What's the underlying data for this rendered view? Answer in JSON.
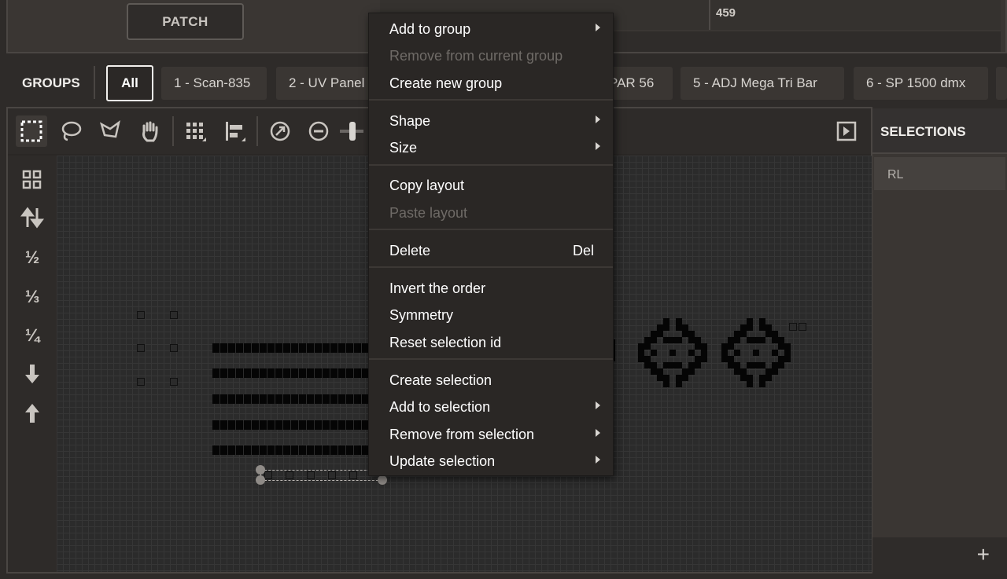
{
  "top": {
    "patch_label": "PATCH",
    "field_value": "459"
  },
  "groups": {
    "title": "GROUPS",
    "tabs": [
      {
        "label": "All",
        "active": true
      },
      {
        "label": "1 - Scan-835"
      },
      {
        "label": "2 - UV Panel"
      },
      {
        "label": "PAR 56"
      },
      {
        "label": "5 - ADJ Mega Tri Bar"
      },
      {
        "label": "6 - SP 1500 dmx"
      }
    ]
  },
  "toolbar": {
    "tools": [
      "select-rect-icon",
      "lasso-icon",
      "polygon-lasso-icon",
      "hand-icon",
      "grid-icon",
      "align-icon",
      "zoom-fit-icon",
      "zoom-out-icon",
      "zoom-slider-icon"
    ],
    "panel_toggle": "panel-toggle-icon"
  },
  "side_tools": {
    "items": [
      "grid-4-icon",
      "swap-vertical-icon",
      "½",
      "⅓",
      "¼",
      "arrow-down-icon",
      "arrow-up-icon"
    ]
  },
  "selections": {
    "title": "SELECTIONS",
    "items": [
      "RL"
    ],
    "add_label": "+"
  },
  "context_menu": {
    "items": [
      {
        "label": "Add to group",
        "submenu": true
      },
      {
        "label": "Remove from current group",
        "disabled": true
      },
      {
        "label": "Create new group"
      },
      {
        "label": "Shape",
        "submenu": true
      },
      {
        "label": "Size",
        "submenu": true
      },
      {
        "label": "Copy layout"
      },
      {
        "label": "Paste layout",
        "disabled": true
      },
      {
        "label": "Delete",
        "shortcut": "Del"
      },
      {
        "label": "Invert the order"
      },
      {
        "label": "Symmetry"
      },
      {
        "label": "Reset selection id"
      },
      {
        "label": "Create selection"
      },
      {
        "label": "Add to selection",
        "submenu": true
      },
      {
        "label": "Remove from selection",
        "submenu": true
      },
      {
        "label": "Update selection",
        "submenu": true
      }
    ]
  }
}
